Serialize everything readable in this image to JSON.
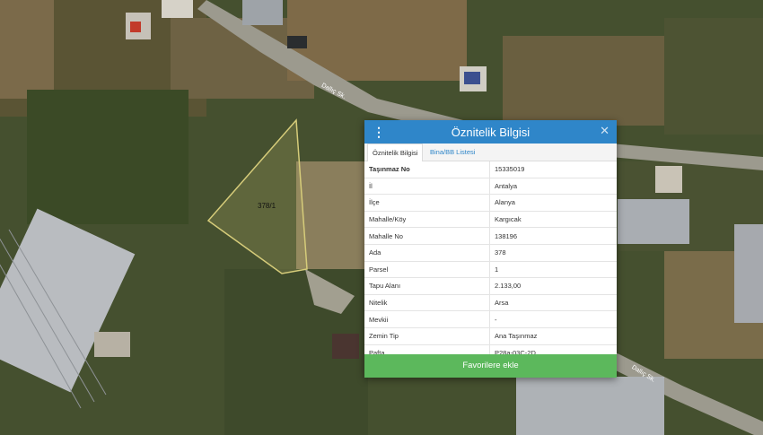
{
  "map": {
    "road_label_1": "Dallıç Sk.",
    "road_label_2": "Dallıç Sk.",
    "parcel_label": "378/1"
  },
  "panel": {
    "title": "Öznitelik Bilgisi",
    "tabs": [
      "Öznitelik Bilgisi",
      "Bina/BB Listesi"
    ],
    "rows": [
      {
        "key": "Taşınmaz No",
        "value": "15335019"
      },
      {
        "key": "İl",
        "value": "Antalya"
      },
      {
        "key": "İlçe",
        "value": "Alanya"
      },
      {
        "key": "Mahalle/Köy",
        "value": "Kargıcak"
      },
      {
        "key": "Mahalle No",
        "value": "138196"
      },
      {
        "key": "Ada",
        "value": "378"
      },
      {
        "key": "Parsel",
        "value": "1"
      },
      {
        "key": "Tapu Alanı",
        "value": "2.133,00"
      },
      {
        "key": "Nitelik",
        "value": "Arsa"
      },
      {
        "key": "Mevkii",
        "value": "-"
      },
      {
        "key": "Zemin Tip",
        "value": "Ana Taşınmaz"
      },
      {
        "key": "Pafta",
        "value": "P28a-03C-2D"
      }
    ],
    "favorite_button": "Favorilere ekle"
  },
  "colors": {
    "header": "#2f86c9",
    "button": "#5cb85c",
    "parcel_outline": "#d6cc7a"
  }
}
